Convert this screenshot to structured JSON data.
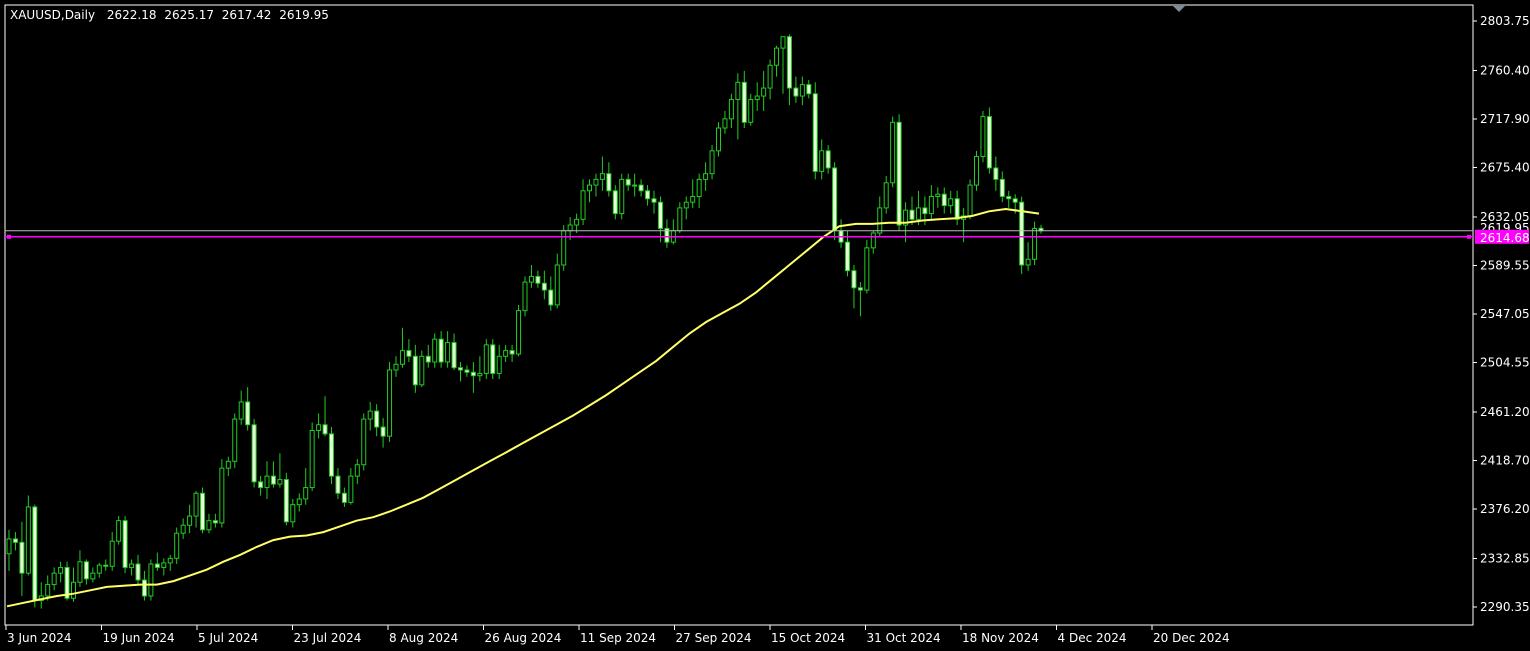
{
  "header": {
    "symbol": "XAUUSD",
    "timeframe": "Daily",
    "open": "2622.18",
    "high": "2625.17",
    "low": "2617.42",
    "close": "2619.95"
  },
  "colors": {
    "background": "#000000",
    "axis": "#ffffff",
    "bull_body": "#000000",
    "bear_body": "#e8ffd8",
    "wick": "#22cc22",
    "moving_average": "#ffff66",
    "hline": "#ff00ff",
    "bid_line": "#bbbbbb"
  },
  "chart_data": {
    "type": "candlestick",
    "title": "",
    "instrument": "XAUUSD",
    "timeframe": "Daily",
    "xlabel": "",
    "ylabel": "",
    "ylim": [
      2270,
      2825
    ],
    "y_ticks": [
      "2803.75",
      "2760.40",
      "2717.90",
      "2675.40",
      "2632.05",
      "2589.55",
      "2547.05",
      "2504.55",
      "2461.20",
      "2418.70",
      "2376.20",
      "2332.85",
      "2290.35"
    ],
    "x_ticks": [
      "3 Jun 2024",
      "19 Jun 2024",
      "5 Jul 2024",
      "23 Jul 2024",
      "8 Aug 2024",
      "26 Aug 2024",
      "11 Sep 2024",
      "27 Sep 2024",
      "15 Oct 2024",
      "31 Oct 2024",
      "18 Nov 2024",
      "4 Dec 2024",
      "20 Dec 2024"
    ],
    "grid": false,
    "horizontal_line": {
      "value": "2614.68"
    },
    "bid_line": {
      "value": "2619.95"
    },
    "moving_average": [
      2291,
      2294,
      2297,
      2300,
      2302,
      2305,
      2308,
      2309,
      2310,
      2310,
      2313,
      2318,
      2323,
      2330,
      2336,
      2343,
      2349,
      2352,
      2353,
      2356,
      2361,
      2366,
      2369,
      2374,
      2380,
      2386,
      2394,
      2402,
      2410,
      2418,
      2426,
      2434,
      2442,
      2450,
      2458,
      2467,
      2476,
      2486,
      2496,
      2506,
      2518,
      2530,
      2540,
      2548,
      2556,
      2566,
      2578,
      2590,
      2602,
      2614,
      2624,
      2626,
      2626,
      2627,
      2627,
      2629,
      2630,
      2631,
      2633,
      2637,
      2639,
      2637,
      2635
    ],
    "candles": [
      {
        "o": 2337,
        "h": 2358,
        "l": 2322,
        "c": 2350
      },
      {
        "o": 2350,
        "h": 2356,
        "l": 2340,
        "c": 2347
      },
      {
        "o": 2347,
        "h": 2365,
        "l": 2300,
        "c": 2320
      },
      {
        "o": 2320,
        "h": 2388,
        "l": 2318,
        "c": 2378
      },
      {
        "o": 2378,
        "h": 2380,
        "l": 2290,
        "c": 2296
      },
      {
        "o": 2296,
        "h": 2312,
        "l": 2289,
        "c": 2300
      },
      {
        "o": 2300,
        "h": 2318,
        "l": 2296,
        "c": 2310
      },
      {
        "o": 2310,
        "h": 2325,
        "l": 2305,
        "c": 2320
      },
      {
        "o": 2320,
        "h": 2330,
        "l": 2312,
        "c": 2325
      },
      {
        "o": 2325,
        "h": 2330,
        "l": 2296,
        "c": 2298
      },
      {
        "o": 2298,
        "h": 2325,
        "l": 2295,
        "c": 2312
      },
      {
        "o": 2312,
        "h": 2340,
        "l": 2308,
        "c": 2330
      },
      {
        "o": 2330,
        "h": 2332,
        "l": 2310,
        "c": 2315
      },
      {
        "o": 2315,
        "h": 2325,
        "l": 2312,
        "c": 2320
      },
      {
        "o": 2320,
        "h": 2329,
        "l": 2316,
        "c": 2327
      },
      {
        "o": 2327,
        "h": 2332,
        "l": 2322,
        "c": 2326
      },
      {
        "o": 2326,
        "h": 2356,
        "l": 2322,
        "c": 2348
      },
      {
        "o": 2348,
        "h": 2370,
        "l": 2345,
        "c": 2366
      },
      {
        "o": 2366,
        "h": 2370,
        "l": 2320,
        "c": 2325
      },
      {
        "o": 2325,
        "h": 2332,
        "l": 2318,
        "c": 2328
      },
      {
        "o": 2328,
        "h": 2336,
        "l": 2310,
        "c": 2314
      },
      {
        "o": 2314,
        "h": 2322,
        "l": 2296,
        "c": 2300
      },
      {
        "o": 2300,
        "h": 2332,
        "l": 2296,
        "c": 2328
      },
      {
        "o": 2328,
        "h": 2338,
        "l": 2322,
        "c": 2325
      },
      {
        "o": 2325,
        "h": 2333,
        "l": 2318,
        "c": 2329
      },
      {
        "o": 2329,
        "h": 2336,
        "l": 2322,
        "c": 2333
      },
      {
        "o": 2333,
        "h": 2360,
        "l": 2328,
        "c": 2355
      },
      {
        "o": 2355,
        "h": 2368,
        "l": 2350,
        "c": 2362
      },
      {
        "o": 2362,
        "h": 2380,
        "l": 2355,
        "c": 2370
      },
      {
        "o": 2370,
        "h": 2392,
        "l": 2360,
        "c": 2390
      },
      {
        "o": 2390,
        "h": 2395,
        "l": 2355,
        "c": 2358
      },
      {
        "o": 2358,
        "h": 2372,
        "l": 2355,
        "c": 2366
      },
      {
        "o": 2366,
        "h": 2372,
        "l": 2360,
        "c": 2364
      },
      {
        "o": 2364,
        "h": 2420,
        "l": 2360,
        "c": 2412
      },
      {
        "o": 2412,
        "h": 2422,
        "l": 2405,
        "c": 2418
      },
      {
        "o": 2418,
        "h": 2460,
        "l": 2412,
        "c": 2455
      },
      {
        "o": 2455,
        "h": 2480,
        "l": 2450,
        "c": 2470
      },
      {
        "o": 2470,
        "h": 2483,
        "l": 2445,
        "c": 2450
      },
      {
        "o": 2450,
        "h": 2455,
        "l": 2395,
        "c": 2400
      },
      {
        "o": 2400,
        "h": 2405,
        "l": 2388,
        "c": 2395
      },
      {
        "o": 2395,
        "h": 2418,
        "l": 2385,
        "c": 2405
      },
      {
        "o": 2405,
        "h": 2418,
        "l": 2395,
        "c": 2398
      },
      {
        "o": 2398,
        "h": 2425,
        "l": 2395,
        "c": 2402
      },
      {
        "o": 2402,
        "h": 2408,
        "l": 2362,
        "c": 2365
      },
      {
        "o": 2365,
        "h": 2385,
        "l": 2360,
        "c": 2380
      },
      {
        "o": 2380,
        "h": 2390,
        "l": 2374,
        "c": 2385
      },
      {
        "o": 2385,
        "h": 2412,
        "l": 2380,
        "c": 2395
      },
      {
        "o": 2395,
        "h": 2452,
        "l": 2392,
        "c": 2445
      },
      {
        "o": 2445,
        "h": 2460,
        "l": 2438,
        "c": 2450
      },
      {
        "o": 2450,
        "h": 2475,
        "l": 2440,
        "c": 2442
      },
      {
        "o": 2442,
        "h": 2448,
        "l": 2398,
        "c": 2405
      },
      {
        "o": 2405,
        "h": 2412,
        "l": 2385,
        "c": 2390
      },
      {
        "o": 2390,
        "h": 2395,
        "l": 2378,
        "c": 2382
      },
      {
        "o": 2382,
        "h": 2412,
        "l": 2380,
        "c": 2405
      },
      {
        "o": 2405,
        "h": 2420,
        "l": 2398,
        "c": 2415
      },
      {
        "o": 2415,
        "h": 2460,
        "l": 2410,
        "c": 2455
      },
      {
        "o": 2455,
        "h": 2470,
        "l": 2445,
        "c": 2462
      },
      {
        "o": 2462,
        "h": 2468,
        "l": 2440,
        "c": 2448
      },
      {
        "o": 2448,
        "h": 2456,
        "l": 2430,
        "c": 2440
      },
      {
        "o": 2440,
        "h": 2505,
        "l": 2435,
        "c": 2498
      },
      {
        "o": 2498,
        "h": 2510,
        "l": 2492,
        "c": 2503
      },
      {
        "o": 2503,
        "h": 2535,
        "l": 2500,
        "c": 2515
      },
      {
        "o": 2515,
        "h": 2525,
        "l": 2505,
        "c": 2510
      },
      {
        "o": 2510,
        "h": 2520,
        "l": 2478,
        "c": 2485
      },
      {
        "o": 2485,
        "h": 2515,
        "l": 2483,
        "c": 2510
      },
      {
        "o": 2510,
        "h": 2520,
        "l": 2500,
        "c": 2505
      },
      {
        "o": 2505,
        "h": 2530,
        "l": 2500,
        "c": 2525
      },
      {
        "o": 2525,
        "h": 2532,
        "l": 2500,
        "c": 2505
      },
      {
        "o": 2505,
        "h": 2532,
        "l": 2500,
        "c": 2522
      },
      {
        "o": 2522,
        "h": 2530,
        "l": 2498,
        "c": 2500
      },
      {
        "o": 2500,
        "h": 2505,
        "l": 2488,
        "c": 2498
      },
      {
        "o": 2498,
        "h": 2502,
        "l": 2492,
        "c": 2496
      },
      {
        "o": 2496,
        "h": 2505,
        "l": 2478,
        "c": 2493
      },
      {
        "o": 2493,
        "h": 2510,
        "l": 2488,
        "c": 2495
      },
      {
        "o": 2495,
        "h": 2525,
        "l": 2490,
        "c": 2520
      },
      {
        "o": 2520,
        "h": 2525,
        "l": 2490,
        "c": 2495
      },
      {
        "o": 2495,
        "h": 2520,
        "l": 2490,
        "c": 2510
      },
      {
        "o": 2510,
        "h": 2520,
        "l": 2505,
        "c": 2515
      },
      {
        "o": 2515,
        "h": 2520,
        "l": 2505,
        "c": 2512
      },
      {
        "o": 2512,
        "h": 2555,
        "l": 2510,
        "c": 2550
      },
      {
        "o": 2550,
        "h": 2580,
        "l": 2545,
        "c": 2575
      },
      {
        "o": 2575,
        "h": 2590,
        "l": 2570,
        "c": 2580
      },
      {
        "o": 2580,
        "h": 2585,
        "l": 2570,
        "c": 2574
      },
      {
        "o": 2574,
        "h": 2585,
        "l": 2560,
        "c": 2568
      },
      {
        "o": 2568,
        "h": 2580,
        "l": 2550,
        "c": 2555
      },
      {
        "o": 2555,
        "h": 2600,
        "l": 2552,
        "c": 2590
      },
      {
        "o": 2590,
        "h": 2625,
        "l": 2585,
        "c": 2620
      },
      {
        "o": 2620,
        "h": 2632,
        "l": 2612,
        "c": 2625
      },
      {
        "o": 2625,
        "h": 2635,
        "l": 2618,
        "c": 2630
      },
      {
        "o": 2630,
        "h": 2665,
        "l": 2625,
        "c": 2655
      },
      {
        "o": 2655,
        "h": 2665,
        "l": 2645,
        "c": 2660
      },
      {
        "o": 2660,
        "h": 2670,
        "l": 2650,
        "c": 2665
      },
      {
        "o": 2665,
        "h": 2685,
        "l": 2655,
        "c": 2670
      },
      {
        "o": 2670,
        "h": 2680,
        "l": 2650,
        "c": 2655
      },
      {
        "o": 2655,
        "h": 2660,
        "l": 2630,
        "c": 2635
      },
      {
        "o": 2635,
        "h": 2670,
        "l": 2630,
        "c": 2665
      },
      {
        "o": 2665,
        "h": 2670,
        "l": 2655,
        "c": 2660
      },
      {
        "o": 2660,
        "h": 2670,
        "l": 2650,
        "c": 2660
      },
      {
        "o": 2660,
        "h": 2665,
        "l": 2650,
        "c": 2655
      },
      {
        "o": 2655,
        "h": 2660,
        "l": 2642,
        "c": 2648
      },
      {
        "o": 2648,
        "h": 2655,
        "l": 2635,
        "c": 2645
      },
      {
        "o": 2645,
        "h": 2650,
        "l": 2610,
        "c": 2622
      },
      {
        "o": 2622,
        "h": 2630,
        "l": 2605,
        "c": 2610
      },
      {
        "o": 2610,
        "h": 2630,
        "l": 2608,
        "c": 2620
      },
      {
        "o": 2620,
        "h": 2645,
        "l": 2618,
        "c": 2640
      },
      {
        "o": 2640,
        "h": 2650,
        "l": 2630,
        "c": 2645
      },
      {
        "o": 2645,
        "h": 2665,
        "l": 2640,
        "c": 2650
      },
      {
        "o": 2650,
        "h": 2670,
        "l": 2640,
        "c": 2665
      },
      {
        "o": 2665,
        "h": 2680,
        "l": 2655,
        "c": 2670
      },
      {
        "o": 2670,
        "h": 2695,
        "l": 2665,
        "c": 2690
      },
      {
        "o": 2690,
        "h": 2715,
        "l": 2685,
        "c": 2710
      },
      {
        "o": 2710,
        "h": 2725,
        "l": 2705,
        "c": 2718
      },
      {
        "o": 2718,
        "h": 2740,
        "l": 2710,
        "c": 2735
      },
      {
        "o": 2735,
        "h": 2758,
        "l": 2700,
        "c": 2750
      },
      {
        "o": 2750,
        "h": 2760,
        "l": 2710,
        "c": 2715
      },
      {
        "o": 2715,
        "h": 2740,
        "l": 2712,
        "c": 2735
      },
      {
        "o": 2735,
        "h": 2750,
        "l": 2725,
        "c": 2738
      },
      {
        "o": 2738,
        "h": 2760,
        "l": 2725,
        "c": 2745
      },
      {
        "o": 2745,
        "h": 2770,
        "l": 2735,
        "c": 2765
      },
      {
        "o": 2765,
        "h": 2782,
        "l": 2755,
        "c": 2780
      },
      {
        "o": 2780,
        "h": 2790,
        "l": 2740,
        "c": 2790
      },
      {
        "o": 2790,
        "h": 2792,
        "l": 2730,
        "c": 2745
      },
      {
        "o": 2745,
        "h": 2755,
        "l": 2732,
        "c": 2738
      },
      {
        "o": 2738,
        "h": 2755,
        "l": 2730,
        "c": 2748
      },
      {
        "o": 2748,
        "h": 2752,
        "l": 2736,
        "c": 2740
      },
      {
        "o": 2740,
        "h": 2750,
        "l": 2665,
        "c": 2672
      },
      {
        "o": 2672,
        "h": 2700,
        "l": 2665,
        "c": 2690
      },
      {
        "o": 2690,
        "h": 2695,
        "l": 2670,
        "c": 2675
      },
      {
        "o": 2675,
        "h": 2680,
        "l": 2612,
        "c": 2620
      },
      {
        "o": 2620,
        "h": 2630,
        "l": 2605,
        "c": 2610
      },
      {
        "o": 2610,
        "h": 2620,
        "l": 2580,
        "c": 2585
      },
      {
        "o": 2585,
        "h": 2590,
        "l": 2552,
        "c": 2570
      },
      {
        "o": 2570,
        "h": 2575,
        "l": 2545,
        "c": 2568
      },
      {
        "o": 2568,
        "h": 2612,
        "l": 2565,
        "c": 2605
      },
      {
        "o": 2605,
        "h": 2620,
        "l": 2600,
        "c": 2618
      },
      {
        "o": 2618,
        "h": 2650,
        "l": 2615,
        "c": 2640
      },
      {
        "o": 2640,
        "h": 2668,
        "l": 2635,
        "c": 2662
      },
      {
        "o": 2662,
        "h": 2720,
        "l": 2658,
        "c": 2715
      },
      {
        "o": 2715,
        "h": 2722,
        "l": 2620,
        "c": 2625
      },
      {
        "o": 2625,
        "h": 2645,
        "l": 2610,
        "c": 2638
      },
      {
        "o": 2638,
        "h": 2650,
        "l": 2625,
        "c": 2630
      },
      {
        "o": 2630,
        "h": 2655,
        "l": 2625,
        "c": 2640
      },
      {
        "o": 2640,
        "h": 2650,
        "l": 2625,
        "c": 2635
      },
      {
        "o": 2635,
        "h": 2660,
        "l": 2630,
        "c": 2650
      },
      {
        "o": 2650,
        "h": 2658,
        "l": 2640,
        "c": 2652
      },
      {
        "o": 2652,
        "h": 2658,
        "l": 2635,
        "c": 2642
      },
      {
        "o": 2642,
        "h": 2655,
        "l": 2635,
        "c": 2648
      },
      {
        "o": 2648,
        "h": 2655,
        "l": 2625,
        "c": 2630
      },
      {
        "o": 2630,
        "h": 2640,
        "l": 2610,
        "c": 2633
      },
      {
        "o": 2633,
        "h": 2665,
        "l": 2630,
        "c": 2660
      },
      {
        "o": 2660,
        "h": 2690,
        "l": 2655,
        "c": 2685
      },
      {
        "o": 2685,
        "h": 2725,
        "l": 2680,
        "c": 2720
      },
      {
        "o": 2720,
        "h": 2728,
        "l": 2670,
        "c": 2675
      },
      {
        "o": 2675,
        "h": 2685,
        "l": 2655,
        "c": 2665
      },
      {
        "o": 2665,
        "h": 2672,
        "l": 2645,
        "c": 2650
      },
      {
        "o": 2650,
        "h": 2655,
        "l": 2640,
        "c": 2648
      },
      {
        "o": 2648,
        "h": 2652,
        "l": 2635,
        "c": 2645
      },
      {
        "o": 2645,
        "h": 2650,
        "l": 2582,
        "c": 2590
      },
      {
        "o": 2590,
        "h": 2610,
        "l": 2585,
        "c": 2595
      },
      {
        "o": 2595,
        "h": 2628,
        "l": 2590,
        "c": 2622
      },
      {
        "o": 2622.18,
        "h": 2625.17,
        "l": 2617.42,
        "c": 2619.95
      }
    ]
  }
}
